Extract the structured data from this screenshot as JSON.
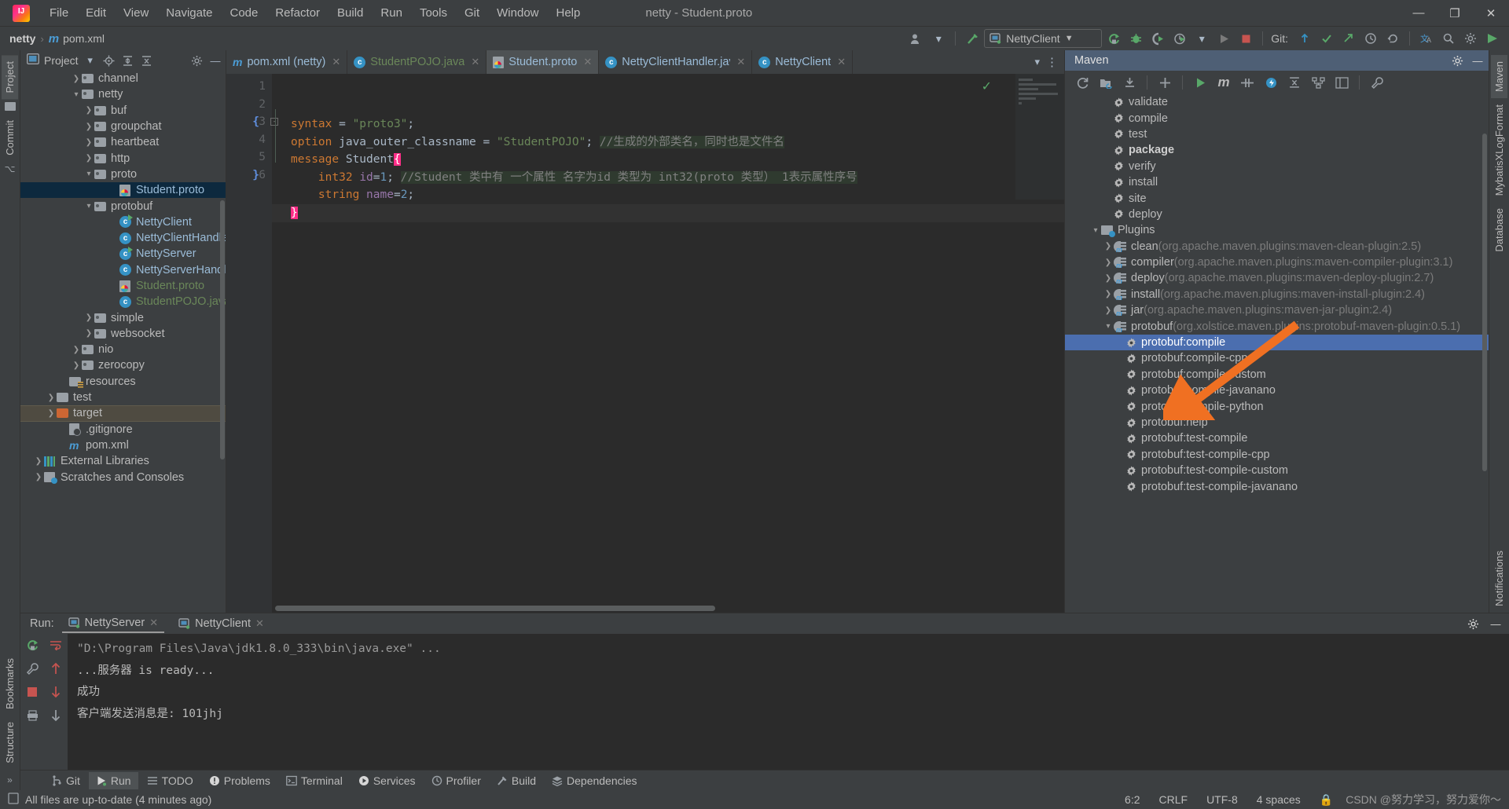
{
  "window": {
    "title": "netty - Student.proto",
    "app_icon": "intellij-logo",
    "minimize": "—",
    "maximize": "❐",
    "close": "✕"
  },
  "menu": {
    "items": [
      "File",
      "Edit",
      "View",
      "Navigate",
      "Code",
      "Refactor",
      "Build",
      "Run",
      "Tools",
      "Git",
      "Window",
      "Help"
    ]
  },
  "navbar": {
    "project": "netty",
    "separator": "›",
    "file": "pom.xml",
    "file_icon": "maven-m-icon",
    "run_config": "NettyClient",
    "git_label": "Git:",
    "icons": [
      "user-avatar-icon",
      "build-hammer-icon",
      "rerun-icon",
      "debug-bug-icon",
      "run-with-coverage-icon",
      "profiler-icon",
      "run-icon",
      "stop-icon",
      "git-update-icon",
      "git-commit-icon",
      "git-push-icon",
      "git-history-icon",
      "undo-icon",
      "translate-icon",
      "search-icon",
      "settings-icon",
      "ide-helper-icon"
    ]
  },
  "left_strip": {
    "tabs": [
      "Project",
      "Commit"
    ],
    "bottom_tabs": [
      "Bookmarks",
      "Structure"
    ]
  },
  "right_strip": {
    "tabs": [
      "Maven",
      "MybatisXLogFormat",
      "Database",
      "Notifications"
    ]
  },
  "project_panel": {
    "title": "Project",
    "header_icons": [
      "chevron-down-icon",
      "locate-icon",
      "expand-all-icon",
      "collapse-all-icon",
      "gear-icon",
      "hide-icon"
    ],
    "tree": [
      {
        "indent": 4,
        "arrow": "right",
        "icon": "folder",
        "label": "channel",
        "color": "plain"
      },
      {
        "indent": 4,
        "arrow": "down",
        "icon": "folder",
        "label": "netty",
        "color": "plain"
      },
      {
        "indent": 5,
        "arrow": "right",
        "icon": "folder",
        "label": "buf",
        "color": "plain"
      },
      {
        "indent": 5,
        "arrow": "right",
        "icon": "folder",
        "label": "groupchat",
        "color": "plain"
      },
      {
        "indent": 5,
        "arrow": "right",
        "icon": "folder",
        "label": "heartbeat",
        "color": "plain"
      },
      {
        "indent": 5,
        "arrow": "right",
        "icon": "folder",
        "label": "http",
        "color": "plain"
      },
      {
        "indent": 5,
        "arrow": "down",
        "icon": "folder",
        "label": "proto",
        "color": "plain"
      },
      {
        "indent": 7,
        "arrow": "none",
        "icon": "proto-file",
        "label": "Student.proto",
        "color": "blue",
        "selected": "blue"
      },
      {
        "indent": 5,
        "arrow": "down",
        "icon": "folder",
        "label": "protobuf",
        "color": "plain"
      },
      {
        "indent": 7,
        "arrow": "none",
        "icon": "class-run",
        "label": "NettyClient",
        "color": "blue"
      },
      {
        "indent": 7,
        "arrow": "none",
        "icon": "class",
        "label": "NettyClientHandler",
        "color": "blue"
      },
      {
        "indent": 7,
        "arrow": "none",
        "icon": "class-run",
        "label": "NettyServer",
        "color": "blue"
      },
      {
        "indent": 7,
        "arrow": "none",
        "icon": "class",
        "label": "NettyServerHandler",
        "color": "blue"
      },
      {
        "indent": 7,
        "arrow": "none",
        "icon": "proto-file",
        "label": "Student.proto",
        "color": "green"
      },
      {
        "indent": 7,
        "arrow": "none",
        "icon": "class",
        "label": "StudentPOJO.java",
        "color": "green"
      },
      {
        "indent": 5,
        "arrow": "right",
        "icon": "folder",
        "label": "simple",
        "color": "plain"
      },
      {
        "indent": 5,
        "arrow": "right",
        "icon": "folder",
        "label": "websocket",
        "color": "plain"
      },
      {
        "indent": 4,
        "arrow": "right",
        "icon": "folder",
        "label": "nio",
        "color": "plain"
      },
      {
        "indent": 4,
        "arrow": "right",
        "icon": "folder",
        "label": "zerocopy",
        "color": "plain"
      },
      {
        "indent": 3,
        "arrow": "none",
        "icon": "resources",
        "label": "resources",
        "color": "plain"
      },
      {
        "indent": 2,
        "arrow": "right",
        "icon": "folder-plain",
        "label": "test",
        "color": "plain"
      },
      {
        "indent": 2,
        "arrow": "right",
        "icon": "folder-orange",
        "label": "target",
        "color": "plain",
        "selected": "tan"
      },
      {
        "indent": 3,
        "arrow": "none",
        "icon": "gitignore",
        "label": ".gitignore",
        "color": "plain"
      },
      {
        "indent": 3,
        "arrow": "none",
        "icon": "maven-m",
        "label": "pom.xml",
        "color": "plain"
      },
      {
        "indent": 1,
        "arrow": "right",
        "icon": "libraries",
        "label": "External Libraries",
        "color": "plain"
      },
      {
        "indent": 1,
        "arrow": "right",
        "icon": "scratches",
        "label": "Scratches and Consoles",
        "color": "plain"
      }
    ]
  },
  "editor": {
    "tabs": [
      {
        "label": "pom.xml (netty)",
        "icon": "maven-m-icon",
        "color": "blue",
        "active": false
      },
      {
        "label": "StudentPOJO.java",
        "icon": "class-icon",
        "color": "green",
        "active": false
      },
      {
        "label": "Student.proto",
        "icon": "proto-icon",
        "color": "blue",
        "active": true
      },
      {
        "label": "NettyClientHandler.java",
        "icon": "class-icon",
        "color": "blue",
        "active": false
      },
      {
        "label": "NettyClient",
        "icon": "class-icon",
        "color": "blue",
        "active": false
      }
    ],
    "inspection_status": "✓",
    "lines": [
      {
        "no": "1",
        "segments": [
          {
            "t": "syntax ",
            "c": "kw"
          },
          {
            "t": "= ",
            "c": "pln"
          },
          {
            "t": "\"proto3\"",
            "c": "str"
          },
          {
            "t": ";",
            "c": "pln"
          }
        ]
      },
      {
        "no": "2",
        "segments": [
          {
            "t": "option ",
            "c": "kw"
          },
          {
            "t": "java_outer_classname ",
            "c": "pln"
          },
          {
            "t": "= ",
            "c": "pln"
          },
          {
            "t": "\"StudentPOJO\"",
            "c": "str"
          },
          {
            "t": "; ",
            "c": "pln"
          },
          {
            "t": "//生成的外部类名，同时也是文件名",
            "c": "cmt"
          }
        ]
      },
      {
        "no": "3",
        "segments": [
          {
            "t": "message ",
            "c": "kw"
          },
          {
            "t": "Student",
            "c": "pln"
          },
          {
            "t": "{",
            "c": "brace-hl"
          }
        ],
        "gutter_brace": "{"
      },
      {
        "no": "4",
        "segments": [
          {
            "t": "    int32 ",
            "c": "kw"
          },
          {
            "t": "id",
            "c": "fld"
          },
          {
            "t": "=",
            "c": "pln"
          },
          {
            "t": "1",
            "c": "num"
          },
          {
            "t": "; ",
            "c": "pln"
          },
          {
            "t": "//Student 类中有 一个属性 名字为id 类型为 int32(proto 类型） 1表示属性序号",
            "c": "cmt"
          }
        ]
      },
      {
        "no": "5",
        "segments": [
          {
            "t": "    string ",
            "c": "kw"
          },
          {
            "t": "name",
            "c": "fld"
          },
          {
            "t": "=",
            "c": "pln"
          },
          {
            "t": "2",
            "c": "num"
          },
          {
            "t": ";",
            "c": "pln"
          }
        ]
      },
      {
        "no": "6",
        "segments": [
          {
            "t": "}",
            "c": "brace-hl"
          }
        ],
        "gutter_brace": "}",
        "current": true
      }
    ]
  },
  "maven_panel": {
    "title": "Maven",
    "toolbar_icons": [
      "reload-icon",
      "add-module-icon",
      "download-sources-icon",
      "add-icon",
      "run-icon",
      "execute-maven-goal-icon",
      "toggle-skip-tests-icon",
      "toggle-offline-icon",
      "collapse-all-icon",
      "show-dependencies-icon",
      "expand-icon",
      "settings-wrench-icon"
    ],
    "header_icons": [
      "gear-icon",
      "hide-icon"
    ],
    "tree": [
      {
        "indent": 3,
        "arrow": "none",
        "icon": "gear",
        "label": "validate",
        "bold": false
      },
      {
        "indent": 3,
        "arrow": "none",
        "icon": "gear",
        "label": "compile",
        "bold": false
      },
      {
        "indent": 3,
        "arrow": "none",
        "icon": "gear",
        "label": "test",
        "bold": false
      },
      {
        "indent": 3,
        "arrow": "none",
        "icon": "gear",
        "label": "package",
        "bold": true
      },
      {
        "indent": 3,
        "arrow": "none",
        "icon": "gear",
        "label": "verify",
        "bold": false
      },
      {
        "indent": 3,
        "arrow": "none",
        "icon": "gear",
        "label": "install",
        "bold": false
      },
      {
        "indent": 3,
        "arrow": "none",
        "icon": "gear",
        "label": "site",
        "bold": false
      },
      {
        "indent": 3,
        "arrow": "none",
        "icon": "gear",
        "label": "deploy",
        "bold": false
      },
      {
        "indent": 2,
        "arrow": "down",
        "icon": "pfolder",
        "label": "Plugins",
        "bold": false
      },
      {
        "indent": 3,
        "arrow": "right",
        "icon": "plugin",
        "label": "clean",
        "dim": "(org.apache.maven.plugins:maven-clean-plugin:2.5)"
      },
      {
        "indent": 3,
        "arrow": "right",
        "icon": "plugin",
        "label": "compiler",
        "dim": "(org.apache.maven.plugins:maven-compiler-plugin:3.1)"
      },
      {
        "indent": 3,
        "arrow": "right",
        "icon": "plugin",
        "label": "deploy",
        "dim": "(org.apache.maven.plugins:maven-deploy-plugin:2.7)"
      },
      {
        "indent": 3,
        "arrow": "right",
        "icon": "plugin",
        "label": "install",
        "dim": "(org.apache.maven.plugins:maven-install-plugin:2.4)"
      },
      {
        "indent": 3,
        "arrow": "right",
        "icon": "plugin",
        "label": "jar",
        "dim": "(org.apache.maven.plugins:maven-jar-plugin:2.4)"
      },
      {
        "indent": 3,
        "arrow": "down",
        "icon": "plugin",
        "label": "protobuf",
        "dim": "(org.xolstice.maven.plugins:protobuf-maven-plugin:0.5.1)"
      },
      {
        "indent": 4,
        "arrow": "none",
        "icon": "gear",
        "label": "protobuf:compile",
        "selected": true
      },
      {
        "indent": 4,
        "arrow": "none",
        "icon": "gear",
        "label": "protobuf:compile-cpp"
      },
      {
        "indent": 4,
        "arrow": "none",
        "icon": "gear",
        "label": "protobuf:compile-custom"
      },
      {
        "indent": 4,
        "arrow": "none",
        "icon": "gear",
        "label": "protobuf:compile-javanano"
      },
      {
        "indent": 4,
        "arrow": "none",
        "icon": "gear",
        "label": "protobuf:compile-python"
      },
      {
        "indent": 4,
        "arrow": "none",
        "icon": "gear",
        "label": "protobuf:help"
      },
      {
        "indent": 4,
        "arrow": "none",
        "icon": "gear",
        "label": "protobuf:test-compile"
      },
      {
        "indent": 4,
        "arrow": "none",
        "icon": "gear",
        "label": "protobuf:test-compile-cpp"
      },
      {
        "indent": 4,
        "arrow": "none",
        "icon": "gear",
        "label": "protobuf:test-compile-custom"
      },
      {
        "indent": 4,
        "arrow": "none",
        "icon": "gear",
        "label": "protobuf:test-compile-javanano"
      }
    ]
  },
  "run_panel": {
    "label": "Run:",
    "tabs": [
      {
        "label": "NettyServer",
        "active": true
      },
      {
        "label": "NettyClient",
        "active": false
      }
    ],
    "header_icons": [
      "gear-icon",
      "hide-icon"
    ],
    "gutter_icons": [
      "rerun-icon",
      "stop-icon",
      "settings-wrench-icon",
      "scroll-up-icon",
      "scroll-down-icon",
      "soft-wrap-icon",
      "print-icon",
      "clear-all-icon"
    ],
    "console_lines": [
      "\"D:\\Program Files\\Java\\jdk1.8.0_333\\bin\\java.exe\" ...",
      "...服务器 is ready...",
      "成功",
      "客户端发送消息是: 101jhj"
    ],
    "watermark": ""
  },
  "tool_window_bar": {
    "items": [
      {
        "label": "Git",
        "icon": "git-branch-icon",
        "active": false
      },
      {
        "label": "Run",
        "icon": "run-icon",
        "active": true
      },
      {
        "label": "TODO",
        "icon": "todo-list-icon",
        "active": false
      },
      {
        "label": "Problems",
        "icon": "problems-icon",
        "active": false
      },
      {
        "label": "Terminal",
        "icon": "terminal-icon",
        "active": false
      },
      {
        "label": "Services",
        "icon": "services-icon",
        "active": false
      },
      {
        "label": "Profiler",
        "icon": "profiler-icon",
        "active": false
      },
      {
        "label": "Build",
        "icon": "build-hammer-icon",
        "active": false
      },
      {
        "label": "Dependencies",
        "icon": "dependencies-icon",
        "active": false
      }
    ]
  },
  "status_bar": {
    "message": "All files are up-to-date (4 minutes ago)",
    "icon": "document-icon",
    "caret": "6:2",
    "line_sep": "CRLF",
    "encoding": "UTF-8",
    "indent": "4 spaces",
    "lock": "🔒",
    "watermark": "CSDN @努力学习，努力爱你～"
  },
  "colors": {
    "accent_blue": "#4b6eaf",
    "panel_bg": "#3c3f41",
    "editor_bg": "#2b2b2b",
    "selection_blue": "#0d293e",
    "arrow_orange": "#f07022",
    "green": "#59a869"
  }
}
